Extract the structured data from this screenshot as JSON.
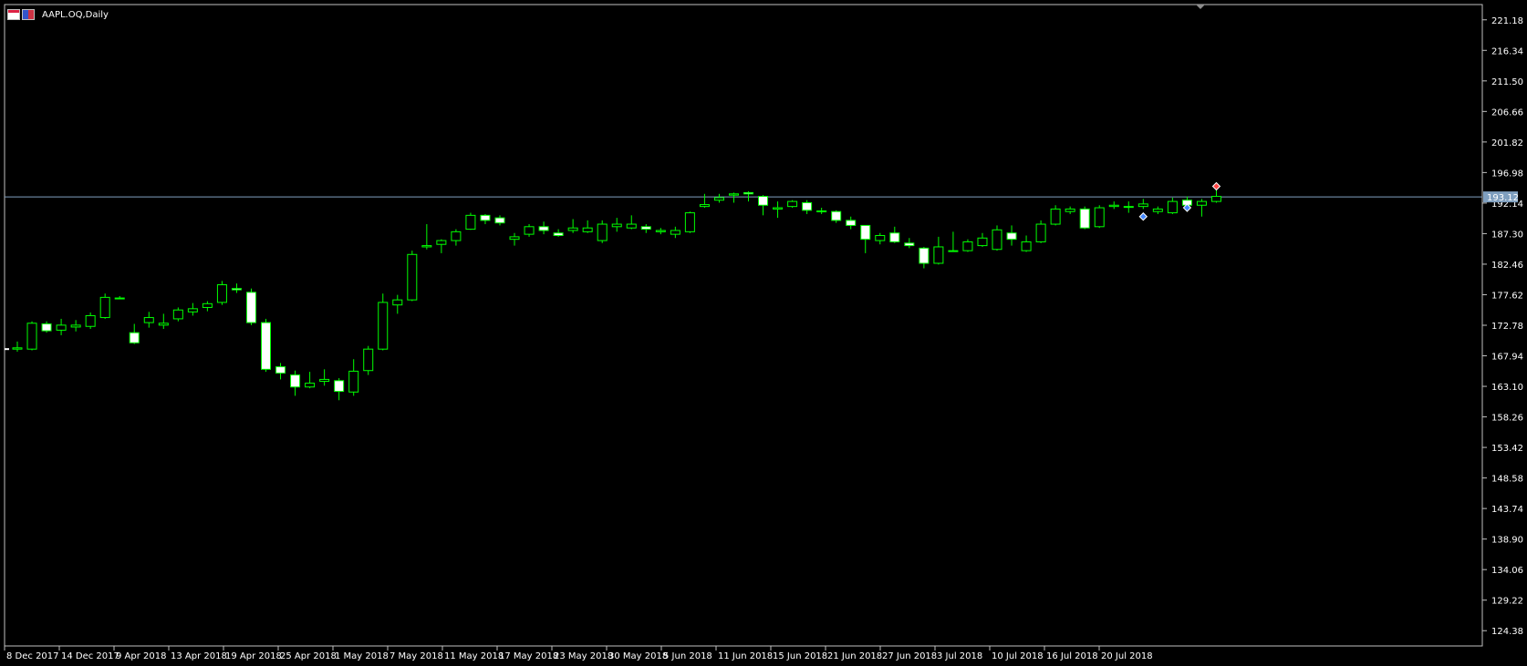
{
  "window": {
    "title": "AAPL.OQ,Daily",
    "icons": [
      "chart-window-icon",
      "chart-type-icon"
    ]
  },
  "colors": {
    "background": "#000000",
    "frame": "#c0c0c0",
    "bull_candle": "#00ff00",
    "bear_body": "#ffffff",
    "axis_text": "#ffffff",
    "price_line": "#7f9fbf",
    "price_badge": "#7f9fbf"
  },
  "current_price_label": "193.12",
  "chart_data": {
    "type": "candlestick",
    "ylim": [
      121.96,
      223.6
    ],
    "yticks": [
      "221.18",
      "216.34",
      "211.50",
      "206.66",
      "201.82",
      "196.98",
      "192.14",
      "187.30",
      "182.46",
      "177.62",
      "172.78",
      "167.94",
      "163.10",
      "158.26",
      "153.42",
      "148.58",
      "143.74",
      "138.90",
      "134.06",
      "129.22",
      "124.38"
    ],
    "xtick_labels": [
      "8 Dec 2017",
      "14 Dec 2017",
      "9 Apr 2018",
      "13 Apr 2018",
      "19 Apr 2018",
      "25 Apr 2018",
      "1 May 2018",
      "7 May 2018",
      "11 May 2018",
      "17 May 2018",
      "23 May 2018",
      "30 May 2018",
      "5 Jun 2018",
      "11 Jun 2018",
      "15 Jun 2018",
      "21 Jun 2018",
      "27 Jun 2018",
      "3 Jul 2018",
      "10 Jul 2018",
      "16 Jul 2018",
      "20 Jul 2018"
    ],
    "current_price": 193.12,
    "candles": [
      {
        "o": 169.0,
        "h": 170.2,
        "l": 168.6,
        "c": 169.2
      },
      {
        "o": 169.0,
        "h": 173.4,
        "l": 168.8,
        "c": 173.1
      },
      {
        "o": 173.0,
        "h": 173.4,
        "l": 171.6,
        "c": 171.9
      },
      {
        "o": 172.0,
        "h": 173.8,
        "l": 171.2,
        "c": 172.8
      },
      {
        "o": 172.5,
        "h": 173.6,
        "l": 171.8,
        "c": 172.8
      },
      {
        "o": 172.6,
        "h": 174.8,
        "l": 172.2,
        "c": 174.3
      },
      {
        "o": 174.0,
        "h": 177.8,
        "l": 173.8,
        "c": 177.2
      },
      {
        "o": 177.1,
        "h": 177.4,
        "l": 176.9,
        "c": 177.1
      },
      {
        "o": 171.6,
        "h": 173.0,
        "l": 169.8,
        "c": 170.0
      },
      {
        "o": 173.2,
        "h": 174.9,
        "l": 172.4,
        "c": 174.0
      },
      {
        "o": 172.8,
        "h": 174.6,
        "l": 172.2,
        "c": 173.1
      },
      {
        "o": 173.8,
        "h": 175.6,
        "l": 173.4,
        "c": 175.2
      },
      {
        "o": 174.9,
        "h": 176.3,
        "l": 174.3,
        "c": 175.4
      },
      {
        "o": 175.6,
        "h": 176.6,
        "l": 175.0,
        "c": 176.2
      },
      {
        "o": 176.4,
        "h": 179.8,
        "l": 176.0,
        "c": 179.2
      },
      {
        "o": 178.6,
        "h": 179.4,
        "l": 177.9,
        "c": 178.4
      },
      {
        "o": 178.0,
        "h": 178.6,
        "l": 172.8,
        "c": 173.2
      },
      {
        "o": 173.2,
        "h": 173.8,
        "l": 165.4,
        "c": 165.8
      },
      {
        "o": 166.2,
        "h": 166.8,
        "l": 164.2,
        "c": 165.2
      },
      {
        "o": 164.9,
        "h": 165.6,
        "l": 161.6,
        "c": 163.0
      },
      {
        "o": 163.0,
        "h": 165.4,
        "l": 162.8,
        "c": 163.6
      },
      {
        "o": 163.9,
        "h": 165.8,
        "l": 163.2,
        "c": 164.2
      },
      {
        "o": 164.0,
        "h": 164.4,
        "l": 160.9,
        "c": 162.3
      },
      {
        "o": 162.2,
        "h": 167.4,
        "l": 161.6,
        "c": 165.5
      },
      {
        "o": 165.6,
        "h": 169.5,
        "l": 164.9,
        "c": 169.0
      },
      {
        "o": 169.0,
        "h": 177.8,
        "l": 168.8,
        "c": 176.4
      },
      {
        "o": 176.0,
        "h": 177.6,
        "l": 174.6,
        "c": 176.8
      },
      {
        "o": 176.8,
        "h": 184.6,
        "l": 176.6,
        "c": 184.0
      },
      {
        "o": 185.2,
        "h": 188.8,
        "l": 184.8,
        "c": 185.4
      },
      {
        "o": 185.6,
        "h": 186.4,
        "l": 184.2,
        "c": 186.2
      },
      {
        "o": 186.2,
        "h": 188.0,
        "l": 185.4,
        "c": 187.6
      },
      {
        "o": 188.0,
        "h": 190.6,
        "l": 187.9,
        "c": 190.2
      },
      {
        "o": 190.2,
        "h": 190.4,
        "l": 188.8,
        "c": 189.4
      },
      {
        "o": 189.8,
        "h": 190.2,
        "l": 188.6,
        "c": 189.0
      },
      {
        "o": 186.4,
        "h": 187.4,
        "l": 185.4,
        "c": 186.8
      },
      {
        "o": 187.2,
        "h": 188.8,
        "l": 186.8,
        "c": 188.4
      },
      {
        "o": 188.4,
        "h": 189.2,
        "l": 187.2,
        "c": 187.8
      },
      {
        "o": 187.4,
        "h": 188.0,
        "l": 186.8,
        "c": 187.0
      },
      {
        "o": 187.8,
        "h": 189.6,
        "l": 187.4,
        "c": 188.2
      },
      {
        "o": 187.6,
        "h": 189.4,
        "l": 187.4,
        "c": 188.2
      },
      {
        "o": 186.2,
        "h": 189.4,
        "l": 185.8,
        "c": 188.8
      },
      {
        "o": 188.4,
        "h": 189.8,
        "l": 187.6,
        "c": 188.8
      },
      {
        "o": 188.2,
        "h": 190.2,
        "l": 188.0,
        "c": 188.8
      },
      {
        "o": 188.4,
        "h": 188.8,
        "l": 187.4,
        "c": 188.0
      },
      {
        "o": 187.6,
        "h": 188.2,
        "l": 187.2,
        "c": 187.8
      },
      {
        "o": 187.2,
        "h": 188.4,
        "l": 186.6,
        "c": 187.8
      },
      {
        "o": 187.6,
        "h": 190.8,
        "l": 187.4,
        "c": 190.6
      },
      {
        "o": 191.6,
        "h": 193.6,
        "l": 191.4,
        "c": 191.9
      },
      {
        "o": 192.6,
        "h": 193.6,
        "l": 192.2,
        "c": 193.0
      },
      {
        "o": 193.4,
        "h": 193.8,
        "l": 192.2,
        "c": 193.6
      },
      {
        "o": 193.8,
        "h": 194.0,
        "l": 192.4,
        "c": 193.6
      },
      {
        "o": 193.2,
        "h": 193.4,
        "l": 190.2,
        "c": 191.8
      },
      {
        "o": 191.2,
        "h": 192.4,
        "l": 189.8,
        "c": 191.4
      },
      {
        "o": 191.6,
        "h": 192.6,
        "l": 191.4,
        "c": 192.4
      },
      {
        "o": 192.2,
        "h": 192.6,
        "l": 190.4,
        "c": 191.0
      },
      {
        "o": 190.8,
        "h": 191.4,
        "l": 190.4,
        "c": 190.9
      },
      {
        "o": 190.8,
        "h": 191.0,
        "l": 189.0,
        "c": 189.4
      },
      {
        "o": 189.4,
        "h": 190.0,
        "l": 188.0,
        "c": 188.6
      },
      {
        "o": 188.6,
        "h": 188.6,
        "l": 184.2,
        "c": 186.4
      },
      {
        "o": 186.2,
        "h": 187.4,
        "l": 185.6,
        "c": 187.0
      },
      {
        "o": 187.4,
        "h": 188.4,
        "l": 185.8,
        "c": 186.0
      },
      {
        "o": 185.8,
        "h": 186.6,
        "l": 185.0,
        "c": 185.4
      },
      {
        "o": 185.0,
        "h": 185.2,
        "l": 181.8,
        "c": 182.6
      },
      {
        "o": 182.6,
        "h": 186.8,
        "l": 182.4,
        "c": 185.2
      },
      {
        "o": 184.6,
        "h": 187.6,
        "l": 184.4,
        "c": 184.6
      },
      {
        "o": 184.6,
        "h": 186.4,
        "l": 184.4,
        "c": 186.0
      },
      {
        "o": 185.4,
        "h": 187.4,
        "l": 185.2,
        "c": 186.6
      },
      {
        "o": 184.8,
        "h": 188.6,
        "l": 184.6,
        "c": 187.9
      },
      {
        "o": 187.4,
        "h": 188.6,
        "l": 185.4,
        "c": 186.4
      },
      {
        "o": 184.6,
        "h": 187.0,
        "l": 184.4,
        "c": 186.0
      },
      {
        "o": 186.0,
        "h": 189.4,
        "l": 185.8,
        "c": 188.8
      },
      {
        "o": 188.8,
        "h": 191.8,
        "l": 188.6,
        "c": 191.2
      },
      {
        "o": 190.8,
        "h": 191.6,
        "l": 190.4,
        "c": 191.2
      },
      {
        "o": 191.2,
        "h": 191.6,
        "l": 188.0,
        "c": 188.2
      },
      {
        "o": 188.4,
        "h": 191.8,
        "l": 188.2,
        "c": 191.4
      },
      {
        "o": 191.6,
        "h": 192.4,
        "l": 191.2,
        "c": 191.8
      },
      {
        "o": 191.6,
        "h": 192.4,
        "l": 190.6,
        "c": 191.6
      },
      {
        "o": 191.6,
        "h": 192.8,
        "l": 191.2,
        "c": 192.0
      },
      {
        "o": 190.8,
        "h": 191.6,
        "l": 190.4,
        "c": 191.2
      },
      {
        "o": 190.6,
        "h": 193.0,
        "l": 190.4,
        "c": 192.4
      },
      {
        "o": 192.6,
        "h": 193.2,
        "l": 190.8,
        "c": 191.8
      },
      {
        "o": 191.8,
        "h": 192.8,
        "l": 190.0,
        "c": 192.4
      },
      {
        "o": 192.4,
        "h": 195.0,
        "l": 192.2,
        "c": 193.2
      }
    ],
    "markers": [
      {
        "index": 77,
        "price": 190.0,
        "color": "#4488ff"
      },
      {
        "index": 80,
        "price": 191.4,
        "color": "#4488ff"
      },
      {
        "index": 82,
        "price": 194.8,
        "color": "#ff4444"
      }
    ]
  }
}
